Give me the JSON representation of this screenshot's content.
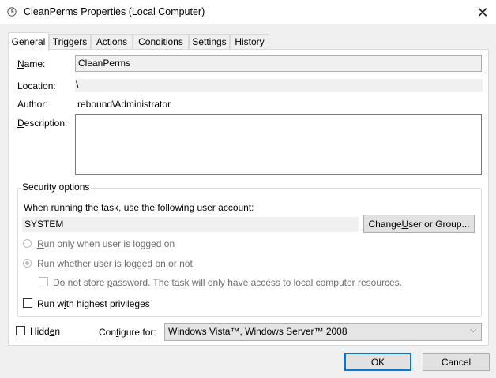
{
  "window": {
    "title": "CleanPerms Properties (Local Computer)",
    "close_glyph": "✕"
  },
  "tabs": [
    {
      "label": "General",
      "active": true
    },
    {
      "label": "Triggers"
    },
    {
      "label": "Actions"
    },
    {
      "label": "Conditions"
    },
    {
      "label": "Settings"
    },
    {
      "label": "History"
    }
  ],
  "general": {
    "name_label_u": "N",
    "name_label_rest": "ame:",
    "name_value": "CleanPerms",
    "location_label": "Location:",
    "location_value": "\\",
    "author_label": "Author:",
    "author_value": "rebound\\Administrator",
    "description_label_u": "D",
    "description_label_rest": "escription:",
    "description_value": ""
  },
  "security": {
    "group_label": "Security options",
    "account_prompt": "When running the task, use the following user account:",
    "account_value": "SYSTEM",
    "change_button_pre": "Change ",
    "change_button_u": "U",
    "change_button_post": "ser or Group...",
    "radio_logged_on": {
      "u": "R",
      "rest": "un only when user is logged on",
      "selected": false
    },
    "radio_whether": {
      "pre": "Run ",
      "u": "w",
      "rest": "hether user is logged on or not",
      "selected": true
    },
    "no_store_password": {
      "pre": "Do not store ",
      "u": "p",
      "rest": "assword.  The task will only have access to local computer resources.",
      "checked": false
    },
    "highest_privileges": {
      "pre": "Run w",
      "u": "i",
      "rest": "th highest privileges",
      "checked": false
    }
  },
  "bottom": {
    "hidden_pre": "Hidd",
    "hidden_u": "e",
    "hidden_post": "n",
    "configure_label_pre": "Con",
    "configure_label_u": "f",
    "configure_label_post": "igure for:",
    "configure_value": "Windows Vista™, Windows Server™ 2008",
    "ok_label": "OK",
    "cancel_label": "Cancel"
  }
}
